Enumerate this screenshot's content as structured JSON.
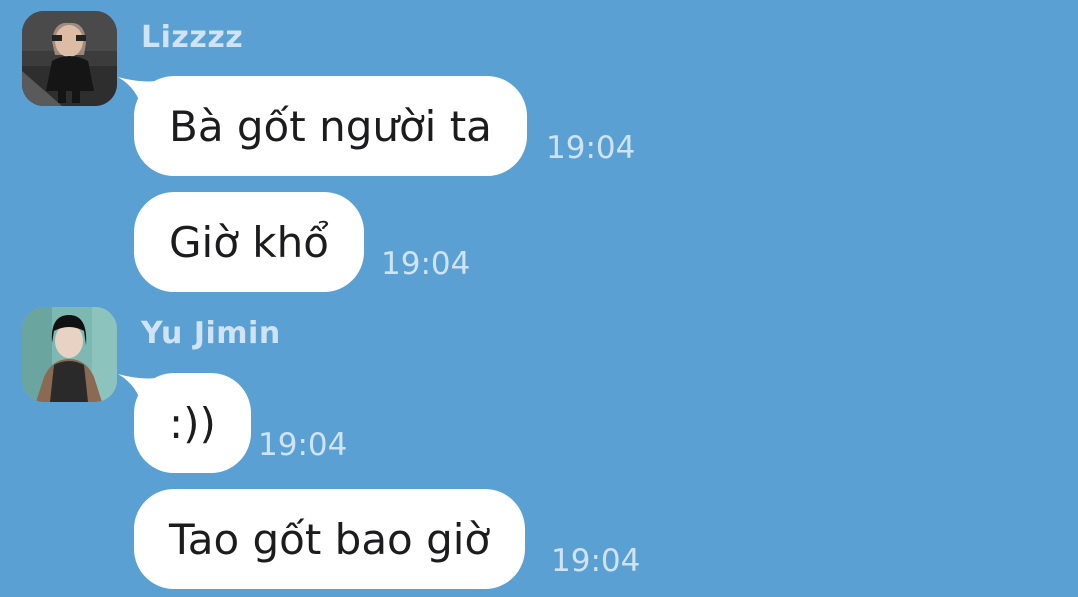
{
  "colors": {
    "background": "#5ba0d2",
    "bubble": "#ffffff",
    "name_and_time": "#cfe3f4",
    "message_text": "#1c1c1e"
  },
  "groups": [
    {
      "sender": "Lizzzz",
      "avatar": "avatar-photo-lizzzz",
      "messages": [
        {
          "text": "Bà gốt người ta",
          "time": "19:04"
        },
        {
          "text": "Giờ khổ",
          "time": "19:04"
        }
      ]
    },
    {
      "sender": "Yu Jimin",
      "avatar": "avatar-photo-yu-jimin",
      "messages": [
        {
          "text": ":))",
          "time": "19:04"
        },
        {
          "text": "Tao gốt bao giờ",
          "time": "19:04"
        }
      ]
    }
  ]
}
